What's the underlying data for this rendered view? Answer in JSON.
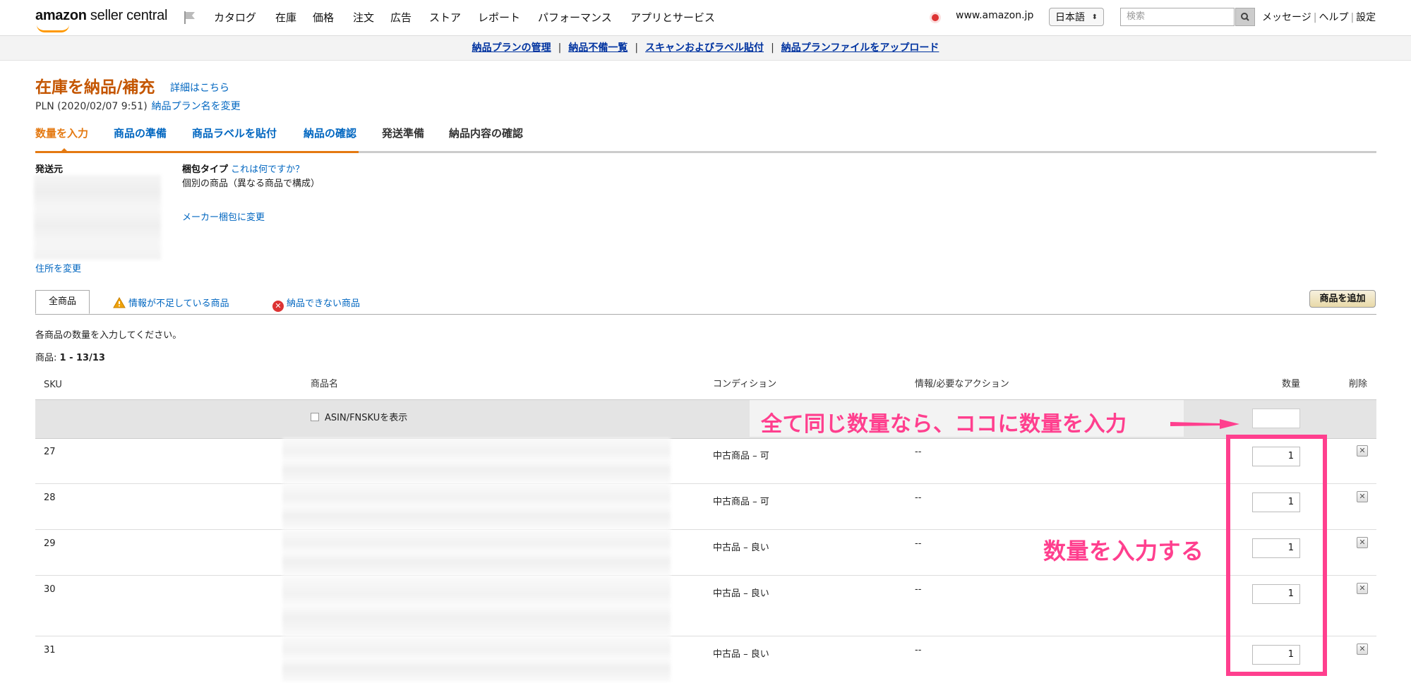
{
  "topbar": {
    "logo_bold": "amazon",
    "logo_rest": " seller central",
    "nav": [
      "カタログ",
      "在庫",
      "価格",
      "注文",
      "広告",
      "ストア",
      "レポート",
      "パフォーマンス",
      "アプリとサービス"
    ],
    "domain": "www.amazon.jp",
    "language": "日本語",
    "search_placeholder": "検索",
    "links": [
      "メッセージ",
      "ヘルプ",
      "設定"
    ]
  },
  "subnav": [
    "納品プランの管理",
    "納品不備一覧",
    "スキャンおよびラベル貼付",
    "納品プランファイルをアップロード"
  ],
  "header": {
    "title": "在庫を納品/補充",
    "detail_link": "詳細はこちら",
    "plan_name": "PLN (2020/02/07 9:51)",
    "rename_link": "納品プラン名を変更"
  },
  "workflow_tabs": [
    "数量を入力",
    "商品の準備",
    "商品ラベルを貼付",
    "納品の確認",
    "発送準備",
    "納品内容の確認"
  ],
  "shipfrom": {
    "label": "発送元",
    "change_link": "住所を変更"
  },
  "packing": {
    "label": "梱包タイプ",
    "help_link": "これは何ですか？",
    "desc": "個別の商品（異なる商品で構成）",
    "change_link": "メーカー梱包に変更"
  },
  "product_tabs": {
    "all": "全商品",
    "missing_info": "情報が不足している商品",
    "ineligible": "納品できない商品",
    "add_button": "商品を追加"
  },
  "instructions": "各商品の数量を入力してください。",
  "count_label": "商品: ",
  "count_value": "1 - 13/13",
  "table": {
    "headers": {
      "sku": "SKU",
      "name": "商品名",
      "condition": "コンディション",
      "info": "情報/必要なアクション",
      "qty": "数量",
      "delete": "削除"
    },
    "asin_toggle": "ASIN/FNSKUを表示",
    "rows": [
      {
        "sku": "27",
        "condition": "中古商品 – 可",
        "info": "--",
        "qty": "1"
      },
      {
        "sku": "28",
        "condition": "中古商品 – 可",
        "info": "--",
        "qty": "1"
      },
      {
        "sku": "29",
        "condition": "中古品 – 良い",
        "info": "--",
        "qty": "1"
      },
      {
        "sku": "30",
        "condition": "中古品 – 良い",
        "info": "--",
        "qty": "1"
      },
      {
        "sku": "31",
        "condition": "中古品 – 良い",
        "info": "--",
        "qty": "1"
      }
    ]
  },
  "annotations": {
    "bulk": "全て同じ数量なら、ココに数量を入力",
    "qty": "数量を入力する"
  },
  "colors": {
    "accent_orange": "#e47911",
    "title_orange": "#c45500",
    "link_blue": "#0066c0",
    "annotation_pink": "#ff3f8e"
  }
}
